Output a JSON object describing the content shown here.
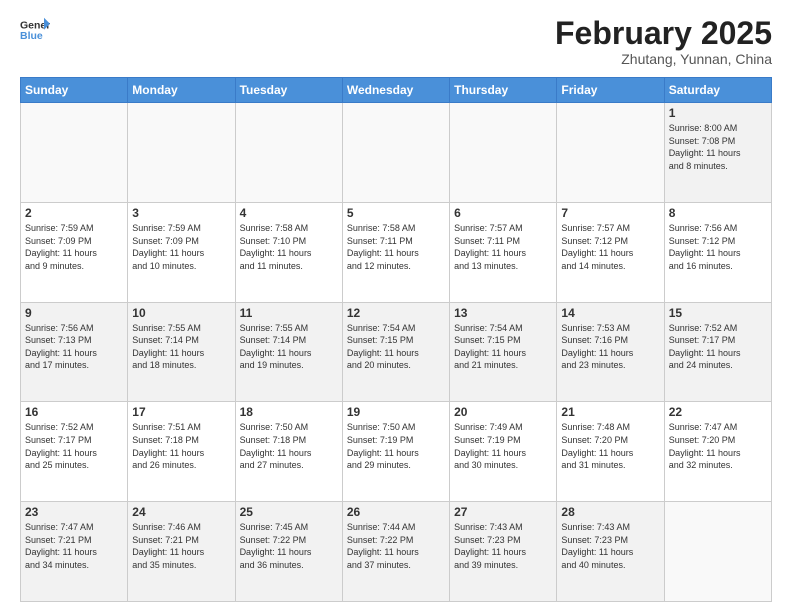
{
  "logo": {
    "line1": "General",
    "line2": "Blue"
  },
  "title": "February 2025",
  "subtitle": "Zhutang, Yunnan, China",
  "weekdays": [
    "Sunday",
    "Monday",
    "Tuesday",
    "Wednesday",
    "Thursday",
    "Friday",
    "Saturday"
  ],
  "weeks": [
    [
      {
        "day": "",
        "info": ""
      },
      {
        "day": "",
        "info": ""
      },
      {
        "day": "",
        "info": ""
      },
      {
        "day": "",
        "info": ""
      },
      {
        "day": "",
        "info": ""
      },
      {
        "day": "",
        "info": ""
      },
      {
        "day": "1",
        "info": "Sunrise: 8:00 AM\nSunset: 7:08 PM\nDaylight: 11 hours\nand 8 minutes."
      }
    ],
    [
      {
        "day": "2",
        "info": "Sunrise: 7:59 AM\nSunset: 7:09 PM\nDaylight: 11 hours\nand 9 minutes."
      },
      {
        "day": "3",
        "info": "Sunrise: 7:59 AM\nSunset: 7:09 PM\nDaylight: 11 hours\nand 10 minutes."
      },
      {
        "day": "4",
        "info": "Sunrise: 7:58 AM\nSunset: 7:10 PM\nDaylight: 11 hours\nand 11 minutes."
      },
      {
        "day": "5",
        "info": "Sunrise: 7:58 AM\nSunset: 7:11 PM\nDaylight: 11 hours\nand 12 minutes."
      },
      {
        "day": "6",
        "info": "Sunrise: 7:57 AM\nSunset: 7:11 PM\nDaylight: 11 hours\nand 13 minutes."
      },
      {
        "day": "7",
        "info": "Sunrise: 7:57 AM\nSunset: 7:12 PM\nDaylight: 11 hours\nand 14 minutes."
      },
      {
        "day": "8",
        "info": "Sunrise: 7:56 AM\nSunset: 7:12 PM\nDaylight: 11 hours\nand 16 minutes."
      }
    ],
    [
      {
        "day": "9",
        "info": "Sunrise: 7:56 AM\nSunset: 7:13 PM\nDaylight: 11 hours\nand 17 minutes."
      },
      {
        "day": "10",
        "info": "Sunrise: 7:55 AM\nSunset: 7:14 PM\nDaylight: 11 hours\nand 18 minutes."
      },
      {
        "day": "11",
        "info": "Sunrise: 7:55 AM\nSunset: 7:14 PM\nDaylight: 11 hours\nand 19 minutes."
      },
      {
        "day": "12",
        "info": "Sunrise: 7:54 AM\nSunset: 7:15 PM\nDaylight: 11 hours\nand 20 minutes."
      },
      {
        "day": "13",
        "info": "Sunrise: 7:54 AM\nSunset: 7:15 PM\nDaylight: 11 hours\nand 21 minutes."
      },
      {
        "day": "14",
        "info": "Sunrise: 7:53 AM\nSunset: 7:16 PM\nDaylight: 11 hours\nand 23 minutes."
      },
      {
        "day": "15",
        "info": "Sunrise: 7:52 AM\nSunset: 7:17 PM\nDaylight: 11 hours\nand 24 minutes."
      }
    ],
    [
      {
        "day": "16",
        "info": "Sunrise: 7:52 AM\nSunset: 7:17 PM\nDaylight: 11 hours\nand 25 minutes."
      },
      {
        "day": "17",
        "info": "Sunrise: 7:51 AM\nSunset: 7:18 PM\nDaylight: 11 hours\nand 26 minutes."
      },
      {
        "day": "18",
        "info": "Sunrise: 7:50 AM\nSunset: 7:18 PM\nDaylight: 11 hours\nand 27 minutes."
      },
      {
        "day": "19",
        "info": "Sunrise: 7:50 AM\nSunset: 7:19 PM\nDaylight: 11 hours\nand 29 minutes."
      },
      {
        "day": "20",
        "info": "Sunrise: 7:49 AM\nSunset: 7:19 PM\nDaylight: 11 hours\nand 30 minutes."
      },
      {
        "day": "21",
        "info": "Sunrise: 7:48 AM\nSunset: 7:20 PM\nDaylight: 11 hours\nand 31 minutes."
      },
      {
        "day": "22",
        "info": "Sunrise: 7:47 AM\nSunset: 7:20 PM\nDaylight: 11 hours\nand 32 minutes."
      }
    ],
    [
      {
        "day": "23",
        "info": "Sunrise: 7:47 AM\nSunset: 7:21 PM\nDaylight: 11 hours\nand 34 minutes."
      },
      {
        "day": "24",
        "info": "Sunrise: 7:46 AM\nSunset: 7:21 PM\nDaylight: 11 hours\nand 35 minutes."
      },
      {
        "day": "25",
        "info": "Sunrise: 7:45 AM\nSunset: 7:22 PM\nDaylight: 11 hours\nand 36 minutes."
      },
      {
        "day": "26",
        "info": "Sunrise: 7:44 AM\nSunset: 7:22 PM\nDaylight: 11 hours\nand 37 minutes."
      },
      {
        "day": "27",
        "info": "Sunrise: 7:43 AM\nSunset: 7:23 PM\nDaylight: 11 hours\nand 39 minutes."
      },
      {
        "day": "28",
        "info": "Sunrise: 7:43 AM\nSunset: 7:23 PM\nDaylight: 11 hours\nand 40 minutes."
      },
      {
        "day": "",
        "info": ""
      }
    ]
  ]
}
